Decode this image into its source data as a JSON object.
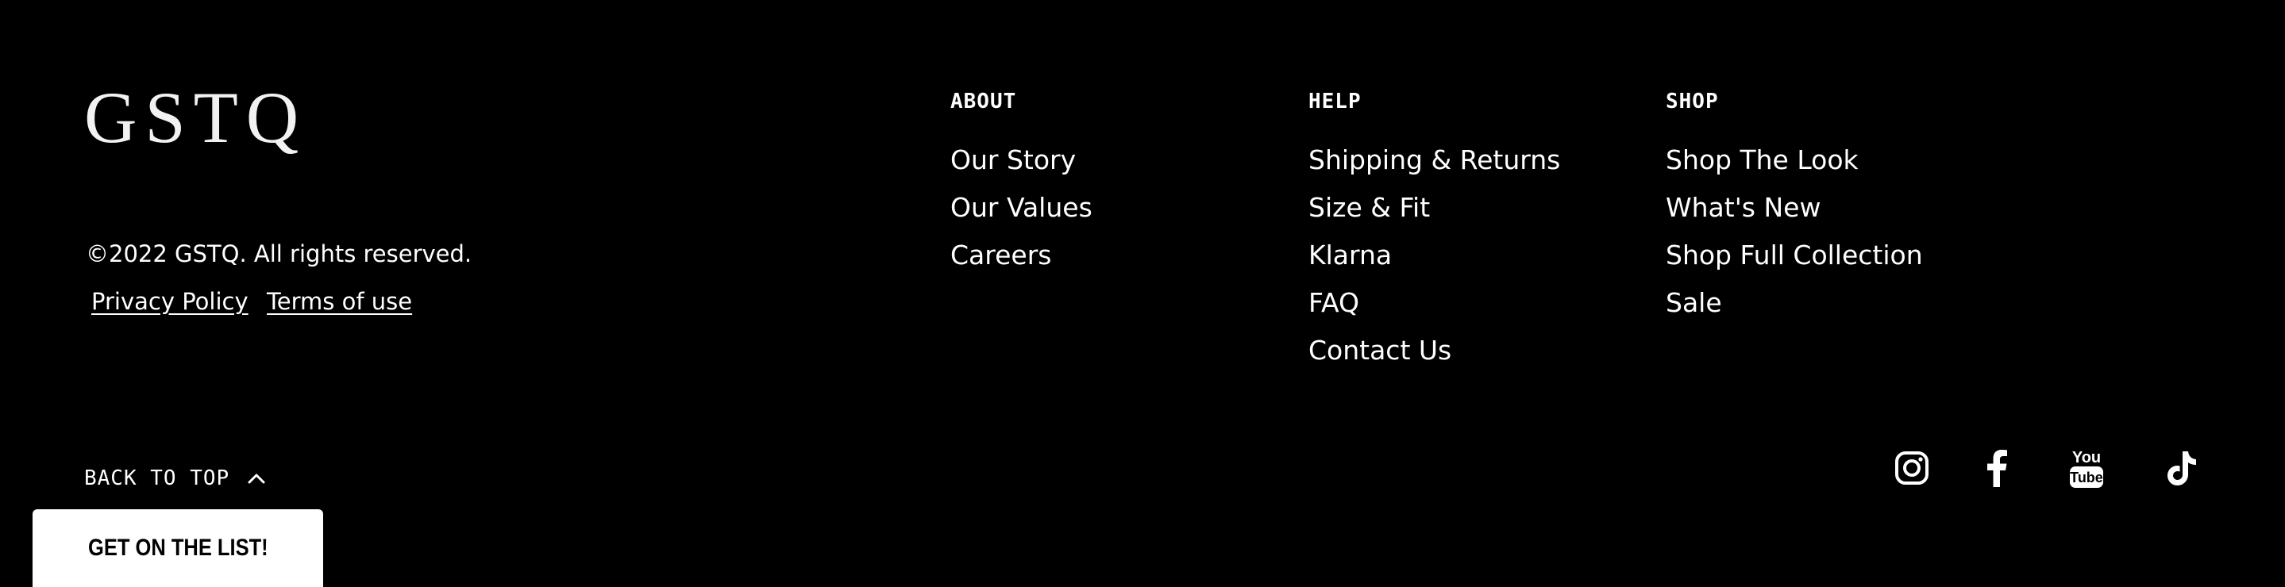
{
  "brand": {
    "logo_text": "GSTQ",
    "copyright": "©2022 GSTQ. All rights reserved."
  },
  "legal": {
    "privacy": "Privacy Policy",
    "terms": "Terms of use"
  },
  "columns": [
    {
      "heading": "ABOUT",
      "links": [
        "Our Story",
        "Our Values",
        "Careers"
      ]
    },
    {
      "heading": "HELP",
      "links": [
        "Shipping & Returns",
        "Size & Fit",
        "Klarna",
        "FAQ",
        "Contact Us"
      ]
    },
    {
      "heading": "SHOP",
      "links": [
        "Shop The Look",
        "What's New",
        "Shop Full Collection",
        "Sale"
      ]
    }
  ],
  "back_to_top": {
    "label": "BACK TO TOP",
    "icon": "chevron-up-icon"
  },
  "social": [
    {
      "name": "instagram",
      "icon": "instagram-icon"
    },
    {
      "name": "facebook",
      "icon": "facebook-icon"
    },
    {
      "name": "youtube",
      "icon": "youtube-icon",
      "text_top": "You",
      "text_bottom": "Tube"
    },
    {
      "name": "tiktok",
      "icon": "tiktok-icon"
    }
  ],
  "signup": {
    "label": "GET ON THE LIST!"
  },
  "colors": {
    "background": "#000000",
    "text": "#ffffff",
    "signup_background": "#ffffff",
    "signup_text": "#000000"
  }
}
